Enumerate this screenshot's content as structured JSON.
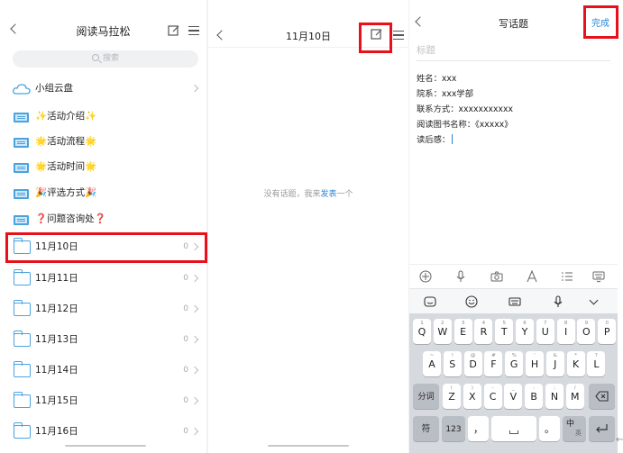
{
  "panel1": {
    "title": "阅读马拉松",
    "search_placeholder": "搜索",
    "cloud_label": "小组云盘",
    "docs": [
      "✨活动介绍✨",
      "🌟活动流程🌟",
      "🌟活动时间🌟",
      "🎉评选方式🎉",
      "❓问题咨询处❓"
    ],
    "folders": [
      {
        "label": "11月10日",
        "count": "0"
      },
      {
        "label": "11月11日",
        "count": "0"
      },
      {
        "label": "11月12日",
        "count": "0"
      },
      {
        "label": "11月13日",
        "count": "0"
      },
      {
        "label": "11月14日",
        "count": "0"
      },
      {
        "label": "11月15日",
        "count": "0"
      },
      {
        "label": "11月16日",
        "count": "0"
      }
    ]
  },
  "panel2": {
    "title": "11月10日",
    "empty_text": "没有话题，我来",
    "empty_link": "发表",
    "empty_tail": "一个"
  },
  "panel3": {
    "title": "写话题",
    "done": "完成",
    "title_placeholder": "标题",
    "lines": [
      "姓名：xxx",
      "院系：xxx学部",
      "联系方式：xxxxxxxxxxx",
      "阅读图书名称：《xxxxx》",
      "读后感："
    ]
  },
  "keyboard": {
    "row1": [
      [
        "Q",
        "1"
      ],
      [
        "W",
        "2"
      ],
      [
        "E",
        "3"
      ],
      [
        "R",
        "4"
      ],
      [
        "T",
        "5"
      ],
      [
        "Y",
        "6"
      ],
      [
        "U",
        "7"
      ],
      [
        "I",
        "8"
      ],
      [
        "O",
        "9"
      ],
      [
        "P",
        "0"
      ]
    ],
    "row2": [
      [
        "A",
        "~"
      ],
      [
        "S",
        "!"
      ],
      [
        "D",
        "@"
      ],
      [
        "F",
        "#"
      ],
      [
        "G",
        "%"
      ],
      [
        "H",
        "'"
      ],
      [
        "J",
        "&"
      ],
      [
        "K",
        "*"
      ],
      [
        "L",
        "?"
      ]
    ],
    "row3": [
      [
        "Z",
        "("
      ],
      [
        "X",
        ")"
      ],
      [
        "C",
        "-"
      ],
      [
        "V",
        "_"
      ],
      [
        "B",
        ":"
      ],
      [
        "N",
        ";"
      ],
      [
        "M",
        "/"
      ]
    ],
    "fenci": "分词",
    "fu": "符",
    "num": "123",
    "comma": "，",
    "period": "。",
    "zhong": "中",
    "ying": "英"
  }
}
